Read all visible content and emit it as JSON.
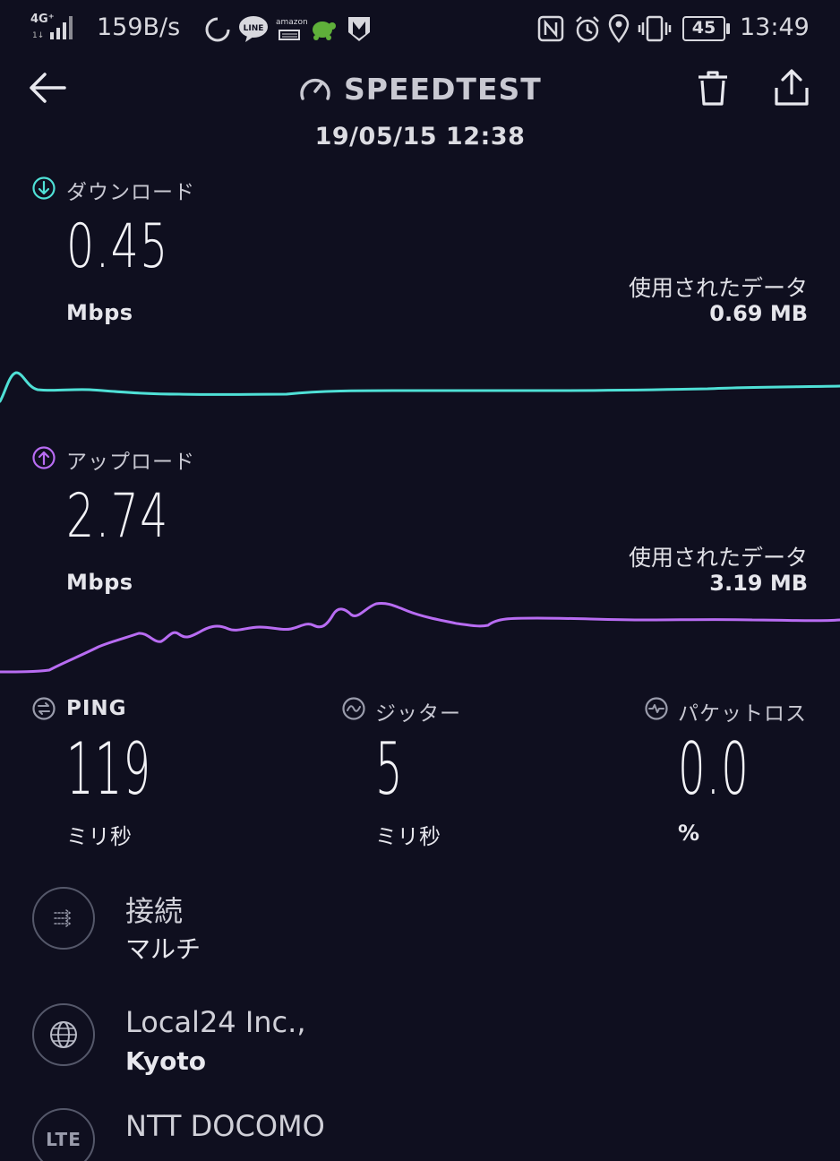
{
  "status_bar": {
    "network": "4G⁺",
    "speed": "159B/s",
    "battery": "45",
    "time": "13:49",
    "amazon_label": "amazon"
  },
  "header": {
    "title": "SPEEDTEST",
    "datetime": "19/05/15 12:38"
  },
  "download": {
    "label": "ダウンロード",
    "value": "0.45",
    "unit": "Mbps",
    "used_label": "使用されたデータ",
    "used_value": "0.69 MB",
    "color": "#4fe0d6"
  },
  "upload": {
    "label": "アップロード",
    "value": "2.74",
    "unit": "Mbps",
    "used_label": "使用されたデータ",
    "used_value": "3.19 MB",
    "color": "#b86cf2"
  },
  "ping": {
    "label": "PING",
    "value": "119",
    "unit": "ミリ秒"
  },
  "jitter": {
    "label": "ジッター",
    "value": "5",
    "unit": "ミリ秒"
  },
  "packet_loss": {
    "label": "パケットロス",
    "value": "0.0",
    "unit": "%"
  },
  "connection": {
    "title": "接続",
    "value": "マルチ"
  },
  "server": {
    "title": "Local24 Inc.,",
    "location": "Kyoto"
  },
  "provider": {
    "icon_text": "LTE",
    "name": "NTT DOCOMO"
  }
}
